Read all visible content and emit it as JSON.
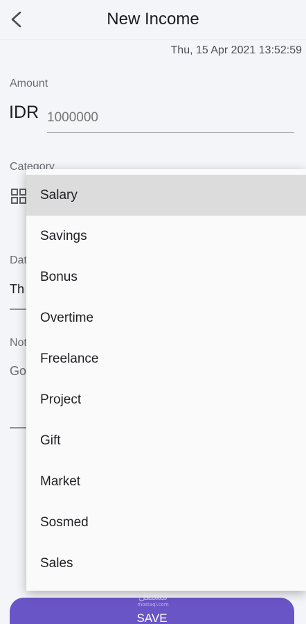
{
  "header": {
    "title": "New Income",
    "back_icon": "chevron-left-icon"
  },
  "timestamp": "Thu, 15 Apr 2021 13:52:59",
  "amount": {
    "label": "Amount",
    "currency": "IDR",
    "placeholder": "1000000"
  },
  "category": {
    "label": "Category",
    "icon": "grid-icon"
  },
  "date": {
    "label_partial": "Dat",
    "value_partial": "Th"
  },
  "note": {
    "label_partial": "Not",
    "value_partial": "Go"
  },
  "menu": {
    "items": [
      {
        "label": "Salary",
        "selected": true
      },
      {
        "label": "Savings"
      },
      {
        "label": "Bonus"
      },
      {
        "label": "Overtime"
      },
      {
        "label": "Freelance"
      },
      {
        "label": "Project"
      },
      {
        "label": "Gift"
      },
      {
        "label": "Market"
      },
      {
        "label": "Sosmed"
      },
      {
        "label": "Sales"
      }
    ]
  },
  "save_button": {
    "label": "SAVE"
  },
  "watermark": {
    "main": "مستقل",
    "sub": "mostaql.com"
  },
  "colors": {
    "accent": "#6a55c6",
    "selected_bg": "#dcdcdc",
    "background": "#f4f5f9"
  }
}
